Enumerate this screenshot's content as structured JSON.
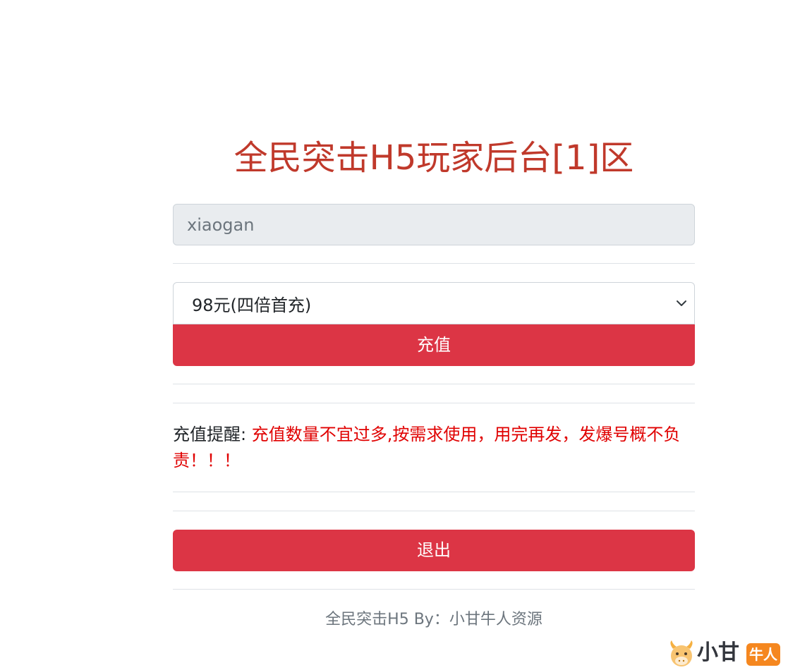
{
  "header": {
    "title": "全民突击H5玩家后台[1]区"
  },
  "form": {
    "username_value": "xiaogan",
    "package_select": {
      "selected": "98元(四倍首充)"
    },
    "recharge_label": "充值"
  },
  "reminder": {
    "label": "充值提醒: ",
    "text": "充值数量不宜过多,按需求使用，用完再发，发爆号概不负责！！！"
  },
  "logout_label": "退出",
  "footer": {
    "text": "全民突击H5 By：小甘牛人资源"
  },
  "watermark": {
    "main": "小甘",
    "badge": "牛人"
  },
  "colors": {
    "title": "#c0392b",
    "button": "#dc3545",
    "reminder_text": "#e00000",
    "input_disabled_bg": "#e9ecef"
  }
}
